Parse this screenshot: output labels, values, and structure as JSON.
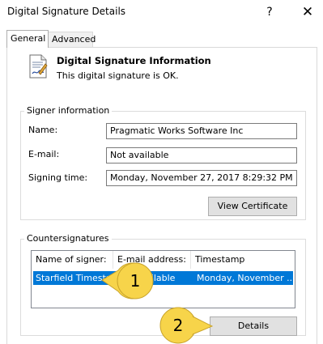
{
  "window": {
    "title": "Digital Signature Details",
    "help_glyph": "?",
    "close_glyph": "✕"
  },
  "tabs": [
    {
      "label": "General",
      "selected": true
    },
    {
      "label": "Advanced",
      "selected": false
    }
  ],
  "info": {
    "icon": "certificate-document-icon",
    "title": "Digital Signature Information",
    "status": "This digital signature is OK."
  },
  "signer": {
    "group_label": "Signer information",
    "name_label": "Name:",
    "name_value": "Pragmatic Works Software Inc",
    "email_label": "E-mail:",
    "email_value": "Not available",
    "time_label": "Signing time:",
    "time_value": "Monday, November  27, 2017 8:29:32 PM",
    "view_cert_label": "View Certificate"
  },
  "countersignatures": {
    "group_label": "Countersignatures",
    "columns": [
      "Name of signer:",
      "E-mail address:",
      "Timestamp"
    ],
    "rows": [
      {
        "name": "Starfield Timesta...",
        "email": "Not available",
        "timestamp": "Monday, November ..."
      }
    ],
    "details_label": "Details"
  },
  "callouts": [
    {
      "number": "1",
      "color": "#f7d44a"
    },
    {
      "number": "2",
      "color": "#f7d44a"
    }
  ],
  "colors": {
    "selection": "#0078d7",
    "button_face": "#e1e1e1",
    "callout_fill": "#f7d44a"
  }
}
